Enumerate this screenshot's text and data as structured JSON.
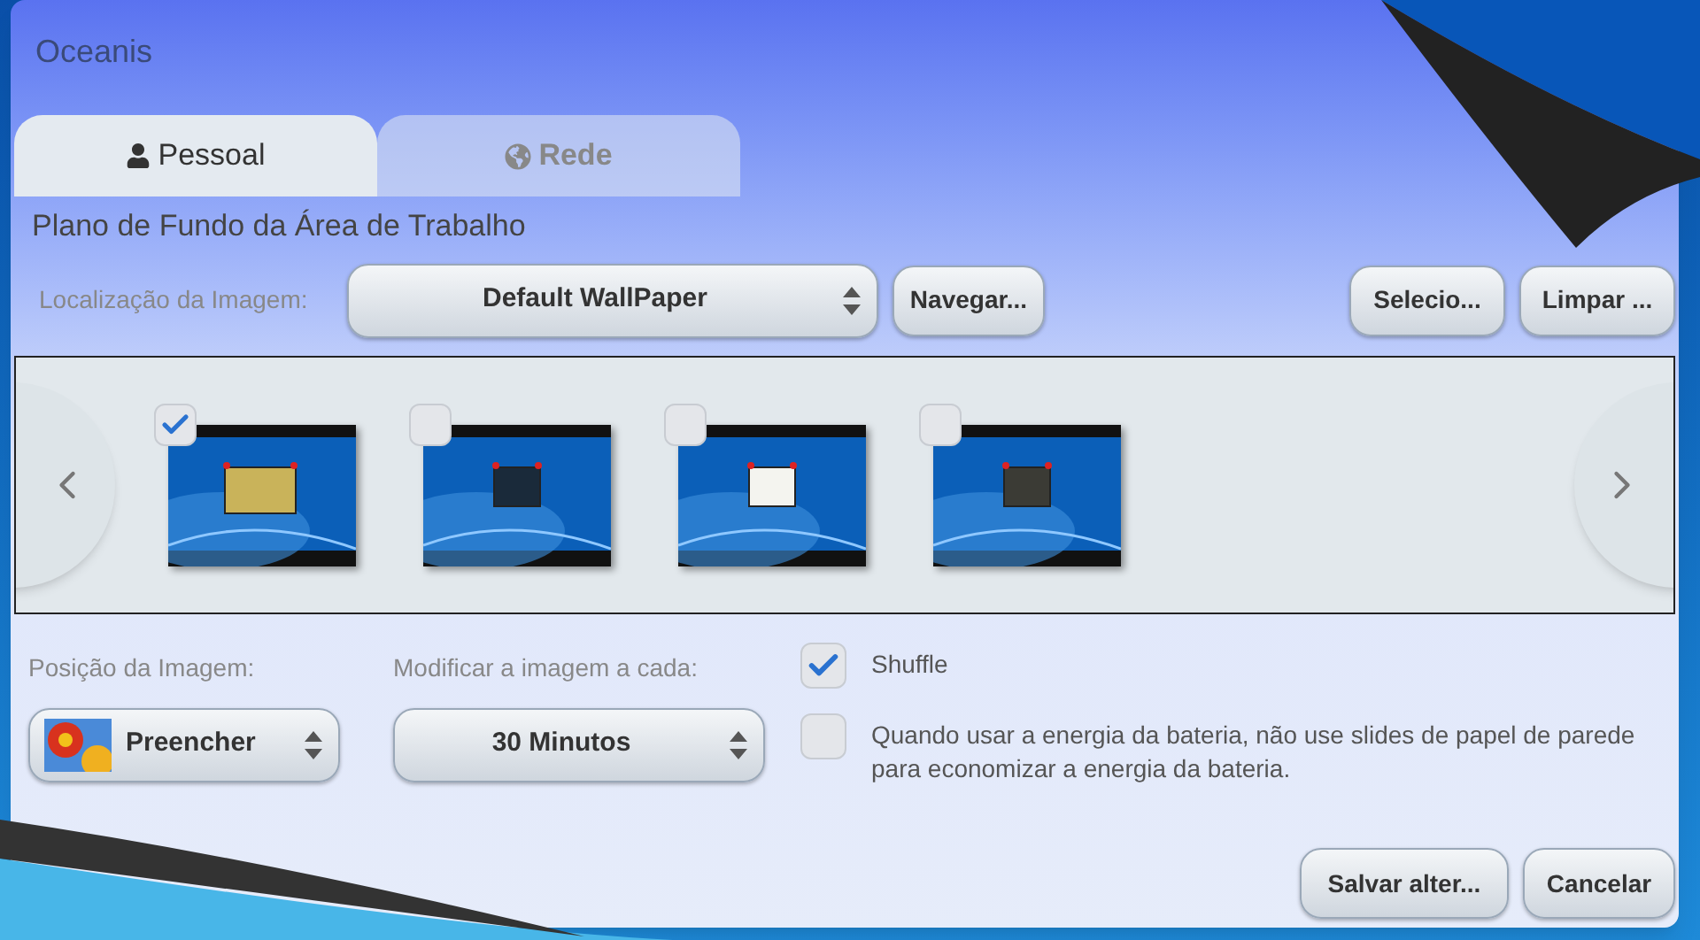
{
  "window": {
    "title": "Oceanis"
  },
  "tabs": [
    {
      "label": "Pessoal",
      "selected": true
    },
    {
      "label": "Rede",
      "selected": false
    }
  ],
  "section_title": "Plano de Fundo da Área de Trabalho",
  "location": {
    "label": "Localização da Imagem:",
    "value": "Default WallPaper"
  },
  "location_buttons": [
    "Navegar...",
    "Selecio...",
    "Limpar ..."
  ],
  "wallpapers": [
    {
      "checked": true,
      "kind": "picture"
    },
    {
      "checked": false,
      "kind": "picture"
    },
    {
      "checked": false,
      "kind": "picture"
    },
    {
      "checked": false,
      "kind": "picture"
    }
  ],
  "position": {
    "label": "Posição da Imagem:",
    "value": "Preencher"
  },
  "interval": {
    "label": "Modificar a imagem a cada:",
    "value": "30 Minutos"
  },
  "options": [
    {
      "label": "Shuffle",
      "checked": true
    },
    {
      "label": "Quando usar a energia da bateria, não use slides de papel de parede para economizar a energia da bateria.",
      "checked": false
    }
  ],
  "buttons": [
    "Salvar alter...",
    "Cancelar"
  ]
}
